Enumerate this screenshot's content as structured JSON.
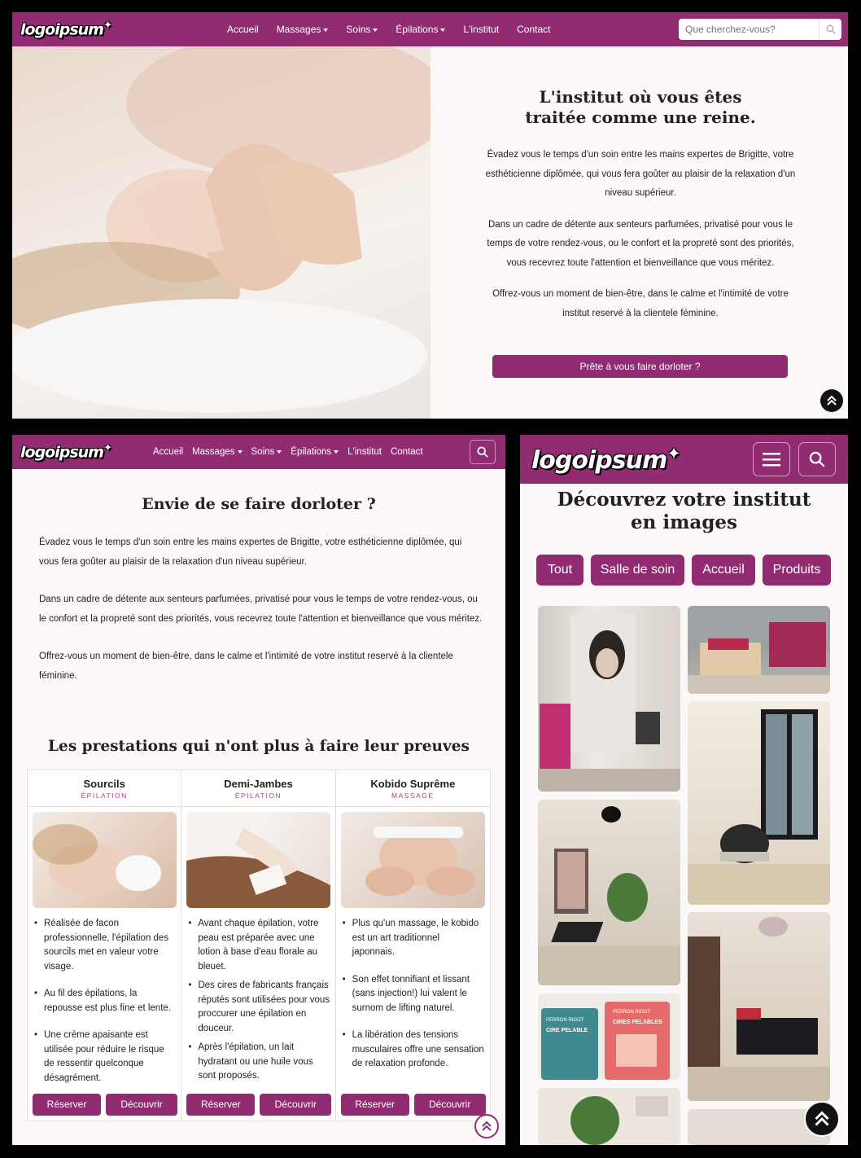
{
  "logo": "logoipsum",
  "nav": {
    "accueil": "Accueil",
    "massages": "Massages",
    "soins": "Soins",
    "epilations": "Épilations",
    "institut": "L'institut",
    "contact": "Contact",
    "search_placeholder": "Que cherchez-vous?"
  },
  "hero": {
    "title": "L'institut où vous êtes traitée comme une reine.",
    "paragraphs": [
      "Évadez vous le temps d'un soin entre les mains expertes de Brigitte, votre esthéticienne diplômée, qui vous fera goûter au plaisir de la relaxation d'un niveau supérieur.",
      "Dans un cadre de détente aux senteurs parfumées, privatisé pour vous le temps de votre rendez-vous, ou le confort et la propreté sont des priorités, vous recevrez toute l'attention et bienveillance que vous méritez.",
      "Offrez-vous un moment de bien-être, dans le calme et l'intimité de votre institut reservé à la clientele féminine."
    ],
    "cta": "Prête à vous faire dorloter ?"
  },
  "tablet": {
    "title": "Envie de se faire dorloter ?",
    "paragraphs": [
      "Évadez vous le temps d'un soin entre les mains expertes de Brigitte, votre esthéticienne diplômée, qui vous fera goûter au plaisir de la relaxation d'un niveau supérieur.",
      "Dans un cadre de détente aux senteurs parfumées, privatisé pour vous le temps de votre rendez-vous, ou le confort et la propreté sont des priorités, vous recevrez toute l'attention et bienveillance que vous méritez.",
      "Offrez-vous un moment de bien-être, dans le calme et l'intimité de votre institut reservé à la clientele féminine."
    ],
    "services_title": "Les prestations qui n'ont plus à faire leur preuves",
    "reserve_label": "Réserver",
    "discover_label": "Découvrir",
    "services": [
      {
        "name": "Sourcils",
        "category": "ÉPILATION",
        "features": [
          "Réalisée de facon professionnelle, l'épilation des sourcils met en valeur votre visage.",
          "Au fil des épilations, la repousse est plus fine et lente.",
          "Une crème apaisante est utilisée pour réduire le risque de ressentir quelconque désagrément."
        ]
      },
      {
        "name": "Demi-Jambes",
        "category": "ÉPILATION",
        "features": [
          "Avant chaque épilation, votre peau est préparée avec une lotion à base d'eau florale au bleuet.",
          "Des cires de fabricants français réputés sont utilisées pour vous proccurer une épilation en douceur.",
          "Après l'épilation, un lait hydratant ou une huile vous sont proposés."
        ]
      },
      {
        "name": "Kobido Suprême",
        "category": "MASSAGE",
        "features": [
          "Plus qu'un massage, le kobido est un art traditionnel japonnais.",
          "Son effet tonnifiant et lissant (sans injection!) lui valent le surnom de lifting naturel.",
          "La libération des tensions musculaires offre une sensation de relaxation profonde."
        ]
      }
    ]
  },
  "mobile": {
    "gallery_title": "Découvrez votre institut en images",
    "filters": [
      "Tout",
      "Salle de soin",
      "Accueil",
      "Produits"
    ],
    "products": {
      "brand": "PERRON RIGOT",
      "left_name": "CIRE PELABLE",
      "right_name": "CIRES PELABLES"
    }
  },
  "colors": {
    "brand": "#922c72",
    "background": "#fbf8f7"
  },
  "icons": {
    "search": "search-icon",
    "menu": "hamburger-icon",
    "scroll_top": "double-chevron-up-icon"
  }
}
